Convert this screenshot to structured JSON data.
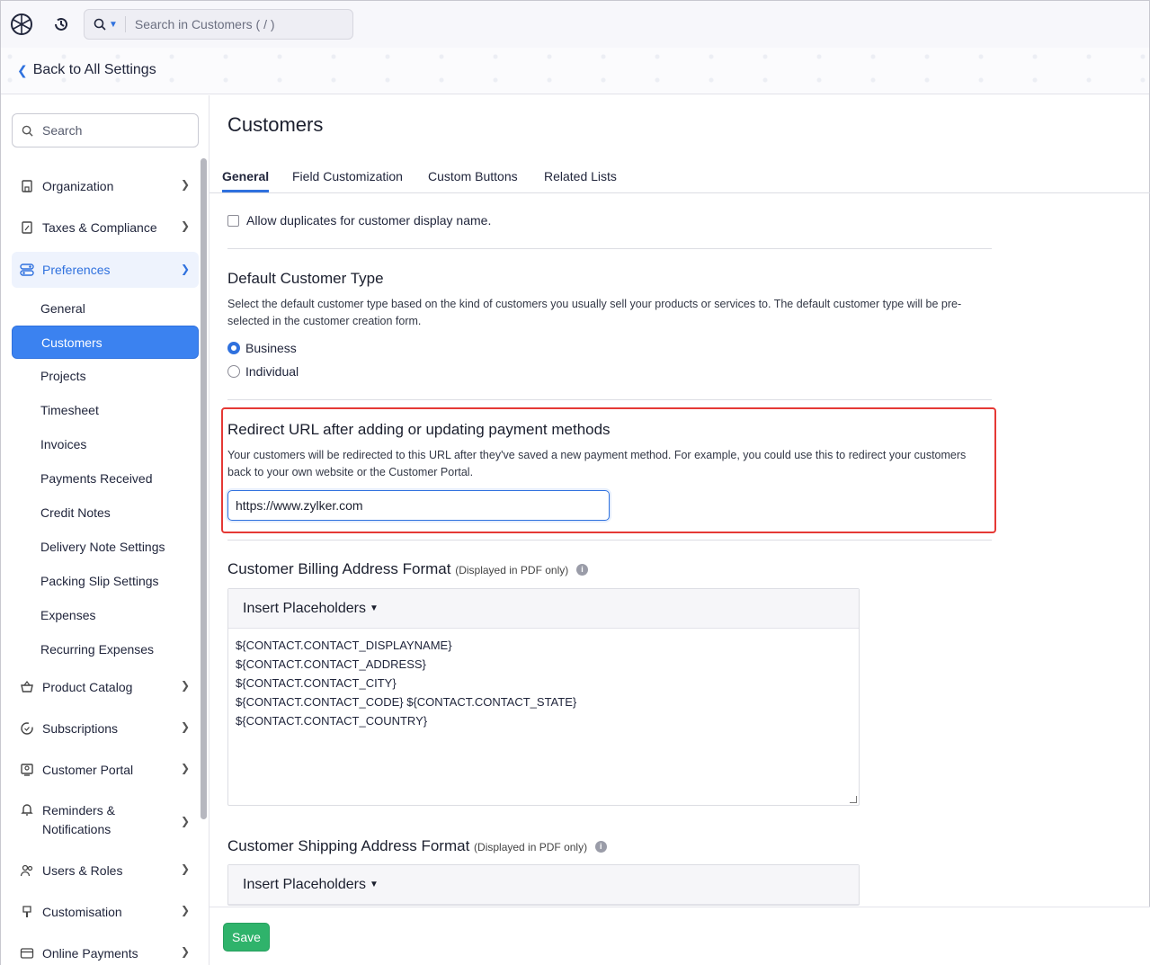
{
  "topbar": {
    "search_placeholder": "Search in Customers ( / )"
  },
  "back_link": "Back to All Settings",
  "sidebar": {
    "search_placeholder": "Search",
    "items": [
      {
        "label": "Organization",
        "icon": "building-icon"
      },
      {
        "label": "Taxes & Compliance",
        "icon": "tax-icon"
      },
      {
        "label": "Preferences",
        "icon": "toggle-icon"
      }
    ],
    "sub_items": [
      "General",
      "Customers",
      "Projects",
      "Timesheet",
      "Invoices",
      "Payments Received",
      "Credit Notes",
      "Delivery Note Settings",
      "Packing Slip Settings",
      "Expenses",
      "Recurring Expenses"
    ],
    "bottom_items": [
      {
        "label": "Product Catalog",
        "icon": "basket-icon"
      },
      {
        "label": "Subscriptions",
        "icon": "refresh-icon"
      },
      {
        "label": "Customer Portal",
        "icon": "portal-icon"
      },
      {
        "label": "Reminders & Notifications",
        "line1": "Reminders &",
        "line2": "Notifications",
        "icon": "bell-icon"
      },
      {
        "label": "Users & Roles",
        "icon": "users-icon"
      },
      {
        "label": "Customisation",
        "icon": "brush-icon"
      },
      {
        "label": "Online Payments",
        "icon": "card-icon"
      }
    ]
  },
  "main": {
    "title": "Customers",
    "tabs": [
      "General",
      "Field Customization",
      "Custom Buttons",
      "Related Lists"
    ],
    "duplicates_label": "Allow duplicates for customer display name.",
    "default_type": {
      "title": "Default Customer Type",
      "desc": "Select the default customer type based on the kind of customers you usually sell your products or services to. The default customer type will be pre-selected in the customer creation form.",
      "options": [
        "Business",
        "Individual"
      ],
      "selected": "Business"
    },
    "redirect": {
      "title": "Redirect URL after adding or updating payment methods",
      "desc": "Your customers will be redirected to this URL after they've saved a new payment method. For example, you could use this to redirect your customers back to your own website or the Customer Portal.",
      "value": "https://www.zylker.com"
    },
    "billing": {
      "title": "Customer Billing Address Format",
      "note": "(Displayed in PDF only)",
      "insert_label": "Insert Placeholders",
      "lines": [
        "${CONTACT.CONTACT_DISPLAYNAME}",
        "${CONTACT.CONTACT_ADDRESS}",
        "${CONTACT.CONTACT_CITY}",
        "${CONTACT.CONTACT_CODE} ${CONTACT.CONTACT_STATE}",
        "${CONTACT.CONTACT_COUNTRY}"
      ]
    },
    "shipping": {
      "title": "Customer Shipping Address Format",
      "note": "(Displayed in PDF only)",
      "insert_label": "Insert Placeholders"
    }
  },
  "footer": {
    "save_label": "Save"
  },
  "colors": {
    "accent": "#2f71de",
    "save": "#2fb36b",
    "highlight": "#e53935"
  }
}
